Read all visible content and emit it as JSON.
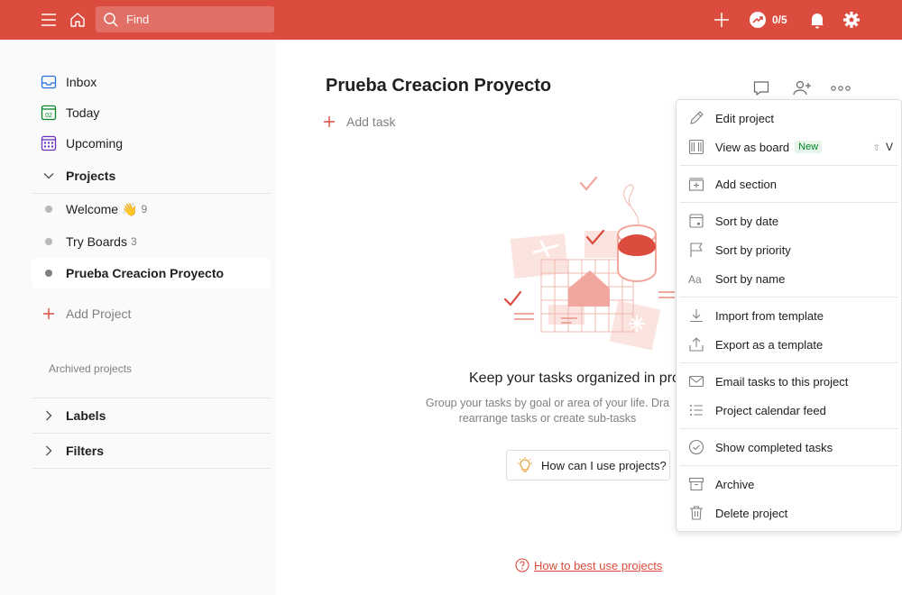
{
  "topbar": {
    "search_placeholder": "Find",
    "karma": "0/5",
    "bg_color": "#db4c3f"
  },
  "sidebar": {
    "inbox": "Inbox",
    "today": "Today",
    "today_date": "02",
    "upcoming": "Upcoming",
    "projects_header": "Projects",
    "projects": [
      {
        "name": "Welcome",
        "emoji": "👋",
        "count": "9"
      },
      {
        "name": "Try Boards",
        "count": "3"
      },
      {
        "name": "Prueba Creacion Proyecto",
        "count": ""
      }
    ],
    "add_project": "Add Project",
    "archived": "Archived projects",
    "labels": "Labels",
    "filters": "Filters"
  },
  "main": {
    "title": "Prueba Creacion Proyecto",
    "add_task": "Add task",
    "empty_title": "Keep your tasks organized in pro",
    "empty_desc_line1": "Group your tasks by goal or area of your life. Dra",
    "empty_desc_line2": "rearrange tasks or create sub-tasks",
    "how_button": "How can I use projects?",
    "help_link": "How to best use projects"
  },
  "menu": {
    "edit_project": "Edit project",
    "view_as_board": "View as board",
    "new_badge": "New",
    "shortcut_shift": "⇧",
    "shortcut_key": "V",
    "add_section": "Add section",
    "sort_by_date": "Sort by date",
    "sort_by_priority": "Sort by priority",
    "sort_by_name": "Sort by name",
    "import_template": "Import from template",
    "export_template": "Export as a template",
    "email_tasks": "Email tasks to this project",
    "calendar_feed": "Project calendar feed",
    "show_completed": "Show completed tasks",
    "archive": "Archive",
    "delete_project": "Delete project"
  }
}
